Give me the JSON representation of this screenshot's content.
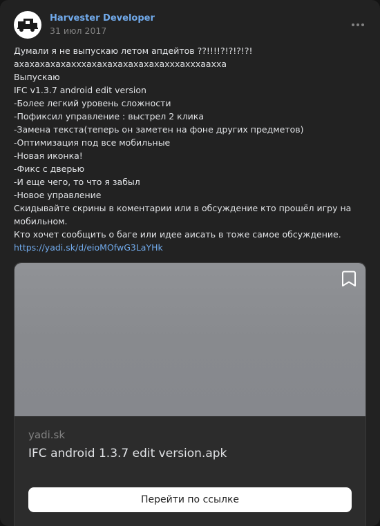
{
  "author": {
    "name": "Harvester Developer",
    "avatar": "harvester-logo"
  },
  "post": {
    "date": "31 июл 2017",
    "more_icon": "more-horizontal-icon",
    "lines": [
      "Думали я не выпускаю летом апдейтов ??!!!!?!?!?!?!",
      "ахахахахахахххахахахахахахахахххахххаахха",
      "Выпускаю",
      "IFC v1.3.7 android edit version",
      "-Более легкий уровень сложности",
      "-Пофиксил управление : выстрел 2 клика",
      "-Замена текста(теперь он заметен на фоне других предметов)",
      "-Оптимизация под все мобильные",
      "-Новая иконка!",
      "-Фикс с дверью",
      "-И еще чего, то что я забыл",
      "-Новое управление"
    ],
    "wrapped_line": "Скидывайте скрины в коментарии или в обсуждение кто прошёл игру на мобильном.",
    "last_line": "Кто хочет сообщить о баге или идее аисать в тоже самое обсуждение.",
    "link": "https://yadi.sk/d/eioMOfwG3LaYHk"
  },
  "attachment": {
    "bookmark_icon": "bookmark-icon",
    "domain": "yadi.sk",
    "title": "IFC android 1.3.7 edit version.apk",
    "button_label": "Перейти по ссылке"
  }
}
